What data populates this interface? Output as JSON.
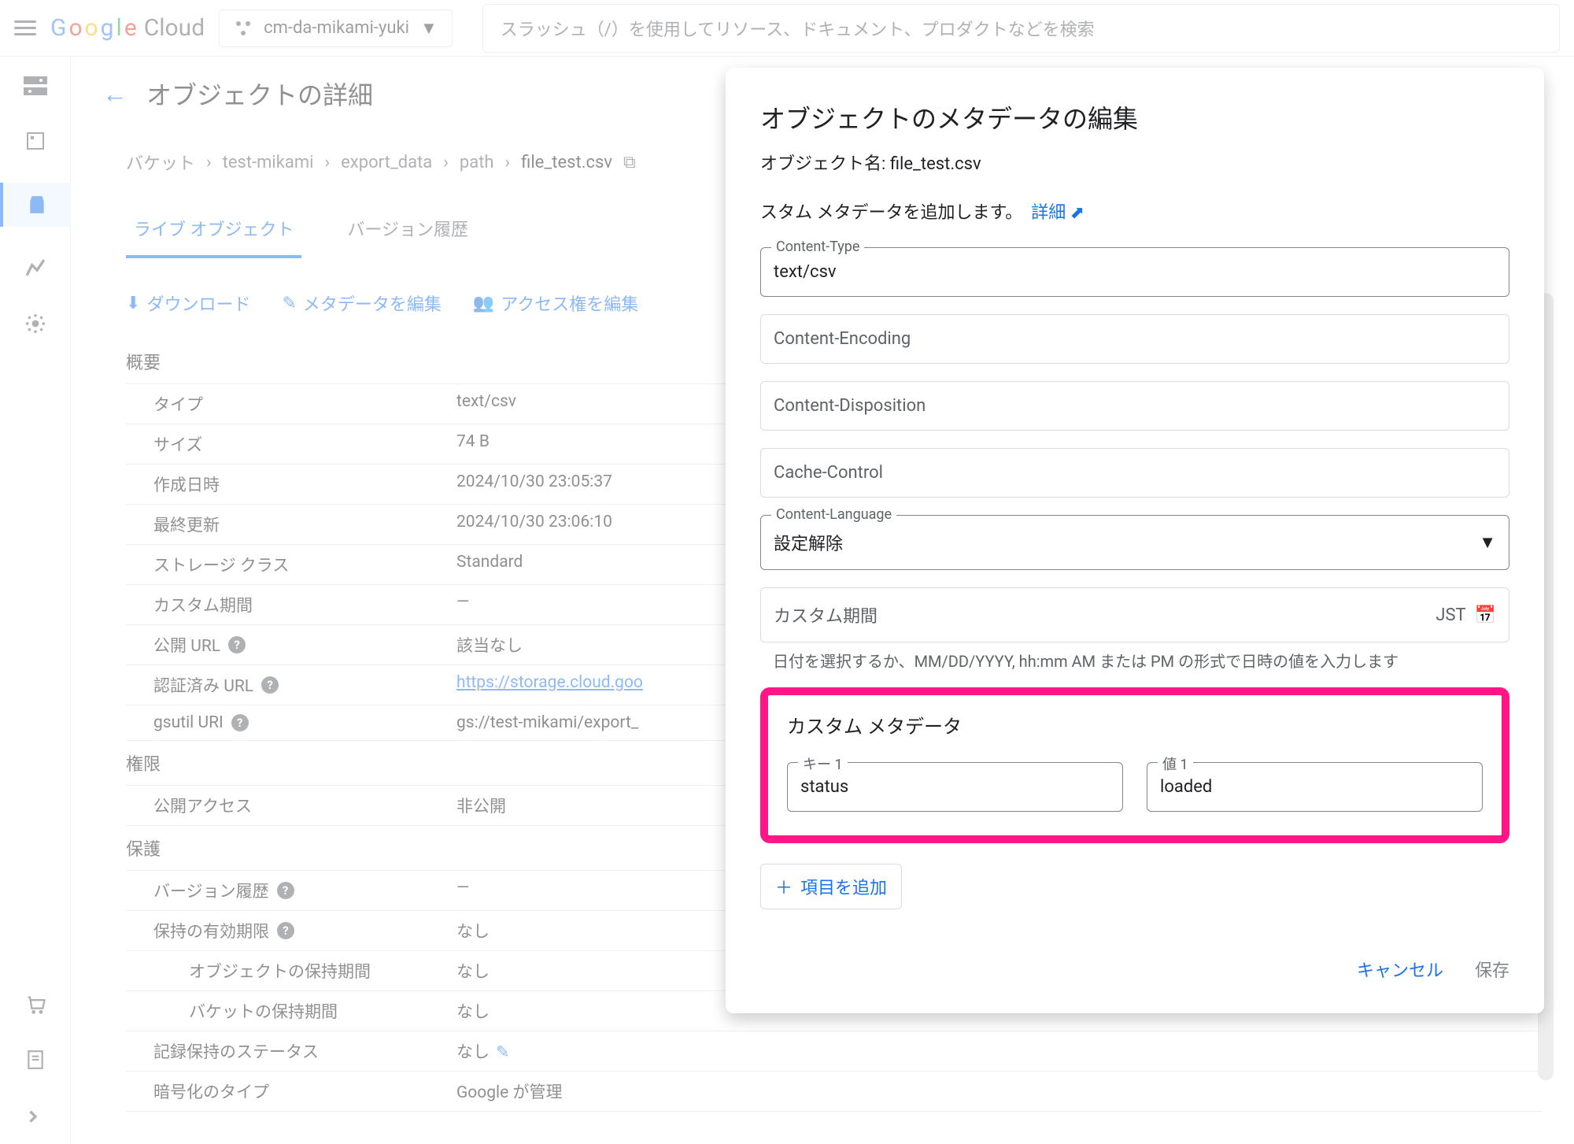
{
  "header": {
    "logo_text": "Google",
    "logo_suffix": "Cloud",
    "project_name": "cm-da-mikami-yuki",
    "search_placeholder": "スラッシュ（/）を使用してリソース、ドキュメント、プロダクトなどを検索"
  },
  "page": {
    "title": "オブジェクトの詳細",
    "breadcrumb": [
      "バケット",
      "test-mikami",
      "export_data",
      "path",
      "file_test.csv"
    ],
    "tabs": {
      "live": "ライブ オブジェクト",
      "versions": "バージョン履歴"
    },
    "actions": {
      "download": "ダウンロード",
      "edit_metadata": "メタデータを編集",
      "edit_access": "アクセス権を編集"
    }
  },
  "details": {
    "overview_head": "概要",
    "rows": {
      "type_label": "タイプ",
      "type_value": "text/csv",
      "size_label": "サイズ",
      "size_value": "74 B",
      "created_label": "作成日時",
      "created_value": "2024/10/30 23:05:37",
      "updated_label": "最終更新",
      "updated_value": "2024/10/30 23:06:10",
      "storage_label": "ストレージ クラス",
      "storage_value": "Standard",
      "custom_time_label": "カスタム期間",
      "custom_time_value": "—",
      "public_url_label": "公開 URL",
      "public_url_value": "該当なし",
      "auth_url_label": "認証済み URL",
      "auth_url_value": "https://storage.cloud.goo",
      "gsutil_label": "gsutil URI",
      "gsutil_value": "gs://test-mikami/export_",
      "perms_head": "権限",
      "public_access_label": "公開アクセス",
      "public_access_value": "非公開",
      "protection_head": "保護",
      "version_history_label": "バージョン履歴",
      "version_history_value": "—",
      "hold_expiry_label": "保持の有効期限",
      "hold_expiry_value": "なし",
      "obj_hold_label": "オブジェクトの保持期間",
      "obj_hold_value": "なし",
      "bucket_hold_label": "バケットの保持期間",
      "bucket_hold_value": "なし",
      "retention_status_label": "記録保持のステータス",
      "retention_status_value": "なし",
      "encryption_label": "暗号化のタイプ",
      "encryption_value": "Google が管理"
    }
  },
  "dialog": {
    "title": "オブジェクトのメタデータの編集",
    "object_name_label": "オブジェクト名:",
    "object_name": "file_test.csv",
    "help_text": "スタム メタデータを追加します。",
    "help_link": "詳細",
    "fields": {
      "content_type_label": "Content-Type",
      "content_type_value": "text/csv",
      "content_encoding_label": "Content-Encoding",
      "content_disposition_label": "Content-Disposition",
      "cache_control_label": "Cache-Control",
      "content_language_label": "Content-Language",
      "content_language_value": "設定解除",
      "custom_time_label": "カスタム期間",
      "custom_time_tz": "JST",
      "date_hint": "日付を選択するか、MM/DD/YYYY, hh:mm AM または PM の形式で日時の値を入力します"
    },
    "custom_metadata": {
      "title": "カスタム メタデータ",
      "key_label": "キー 1",
      "key_value": "status",
      "value_label": "値 1",
      "value_value": "loaded"
    },
    "add_item": "項目を追加",
    "cancel": "キャンセル",
    "save": "保存"
  }
}
